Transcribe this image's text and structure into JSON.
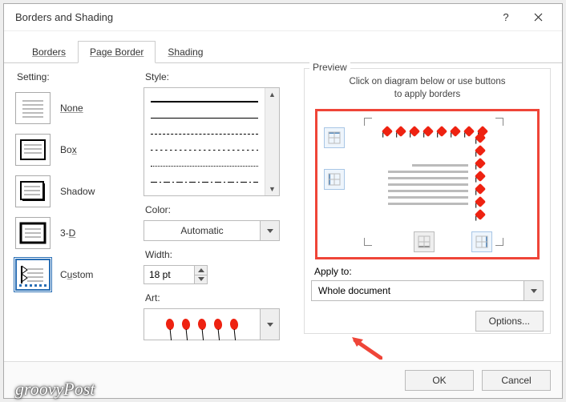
{
  "dialog": {
    "title": "Borders and Shading"
  },
  "tabs": {
    "borders": "Borders",
    "page_border": "Page Border",
    "shading": "Shading"
  },
  "setting": {
    "label": "Setting:",
    "none": "None",
    "box": "Box",
    "shadow": "Shadow",
    "threeD": "3-D",
    "custom": "Custom"
  },
  "style": {
    "label": "Style:",
    "color_label": "Color:",
    "color_value": "Automatic",
    "width_label": "Width:",
    "width_value": "18 pt",
    "art_label": "Art:"
  },
  "preview": {
    "legend": "Preview",
    "hint_line1": "Click on diagram below or use buttons",
    "hint_line2": "to apply borders",
    "apply_label": "Apply to:",
    "apply_value": "Whole document",
    "options": "Options..."
  },
  "footer": {
    "ok": "OK",
    "cancel": "Cancel"
  },
  "watermark": "groovyPost",
  "chart_data": {
    "type": "table",
    "title": "Borders and Shading — Page Border settings",
    "settings_options": [
      "None",
      "Box",
      "Shadow",
      "3-D",
      "Custom"
    ],
    "settings_selected": "Custom",
    "style_selected_index": 0,
    "color": "Automatic",
    "width_pt": 18,
    "art": "red-balloons",
    "apply_to_options": [
      "Whole document"
    ],
    "apply_to_selected": "Whole document",
    "preview_borders_on": {
      "top": true,
      "right": true,
      "bottom": false,
      "left": false
    }
  }
}
